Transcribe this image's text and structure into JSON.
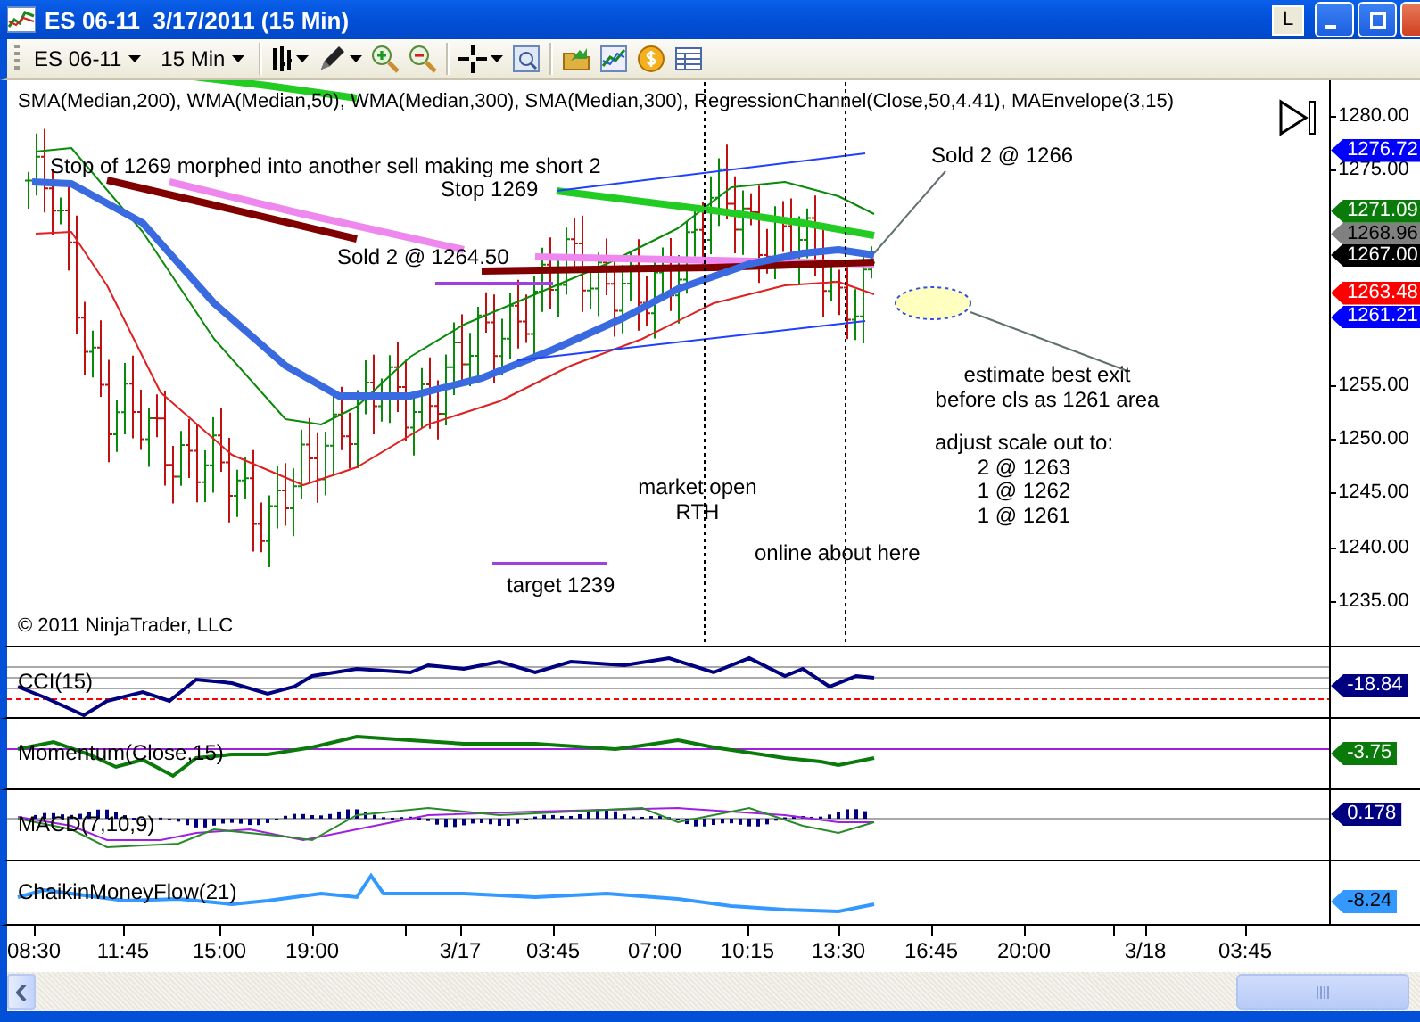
{
  "window": {
    "title": "ES 06-11  3/17/2011 (15 Min)",
    "buttons": [
      "L"
    ]
  },
  "toolbar": {
    "instrument": "ES 06-11",
    "interval": "15 Min"
  },
  "price_panel": {
    "indicators": "SMA(Median,200), WMA(Median,50), WMA(Median,300),  SMA(Median,300), RegressionChannel(Close,50,4.41), MAEnvelope(3,15)",
    "copyright": "© 2011 NinjaTrader, LLC",
    "annotations": [
      {
        "lines": [
          "Stop of 1269 morphed into another sell making me short 2"
        ]
      },
      {
        "lines": [
          "Stop 1269"
        ]
      },
      {
        "lines": [
          "Sold 2 @ 1264.50"
        ]
      },
      {
        "lines": [
          "Sold 2 @ 1266"
        ]
      },
      {
        "lines": [
          "estimate best exit",
          "before cls as 1261 area"
        ]
      },
      {
        "lines": [
          "market open",
          "RTH"
        ]
      },
      {
        "lines": [
          "adjust scale out to:",
          "2 @ 1263",
          "1 @ 1262",
          "1 @ 1261"
        ]
      },
      {
        "lines": [
          "online about here"
        ]
      },
      {
        "lines": [
          "target 1239"
        ]
      }
    ],
    "axis_labels": [
      "1280.00",
      "1275.00",
      "1255.00",
      "1250.00",
      "1245.00",
      "1240.00",
      "1235.00"
    ],
    "price_badges": [
      {
        "text": "1276.72",
        "color": "#0000ff"
      },
      {
        "text": "1271.09",
        "color": "#0a7a0a"
      },
      {
        "text": "1268.96",
        "color": "#808080"
      },
      {
        "text": "1267.00",
        "color": "#000000"
      },
      {
        "text": "1263.48",
        "color": "#ff0000"
      },
      {
        "text": "1261.21",
        "color": "#0000ff"
      }
    ]
  },
  "indicator_panels": [
    {
      "kind": "cci",
      "label": "CCI(15)",
      "value": "-18.84",
      "color": "#000080"
    },
    {
      "kind": "momentum",
      "label": "Momentum(Close,15)",
      "value": "-3.75",
      "color": "#0a7a0a"
    },
    {
      "kind": "macd",
      "label": "MACD(7,10,9)",
      "value": "0.178",
      "color": "#000080"
    },
    {
      "kind": "cmf",
      "label": "ChaikinMoneyFlow(21)",
      "value": "-8.24",
      "color": "#3399ff"
    }
  ],
  "time_axis": [
    "08:30",
    "11:45",
    "15:00",
    "19:00",
    "3/17",
    "03:45",
    "07:00",
    "10:15",
    "13:30",
    "16:45",
    "20:00",
    "3/18",
    "03:45"
  ]
}
